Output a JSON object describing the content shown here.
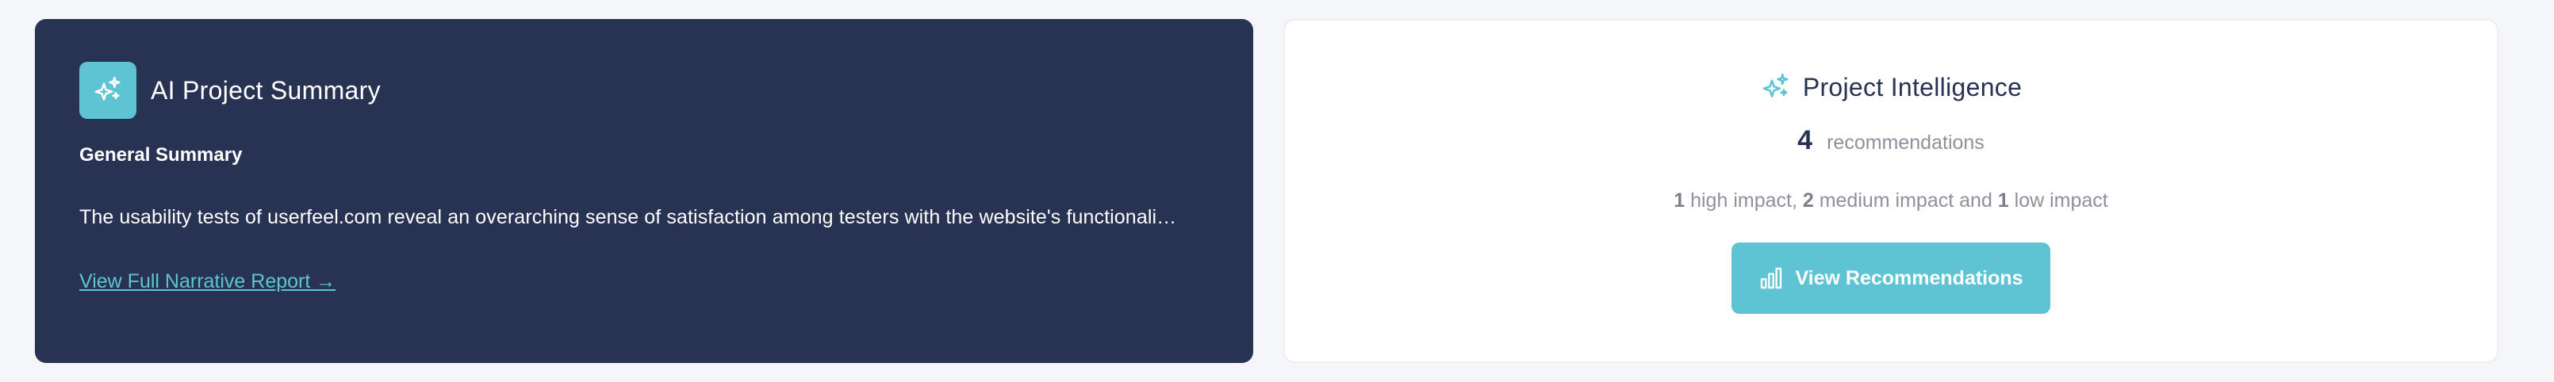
{
  "summary_card": {
    "title": "AI Project Summary",
    "subtitle": "General Summary",
    "text": "The usability tests of userfeel.com reveal an overarching sense of satisfaction among testers with the website's functionali…",
    "link_label": "View Full Narrative Report →",
    "icon": "sparkles-icon"
  },
  "intelligence_card": {
    "title": "Project Intelligence",
    "icon": "sparkles-icon",
    "count": "4",
    "count_label": "recommendations",
    "impact": {
      "high_count": "1",
      "high_label": " high impact, ",
      "medium_count": "2",
      "medium_label": " medium impact and ",
      "low_count": "1",
      "low_label": " low impact"
    },
    "button_label": "View Recommendations",
    "button_icon": "bar-chart-icon"
  },
  "colors": {
    "summary_bg": "#283252",
    "accent": "#5ec4d3",
    "page_bg": "#f5f6fa",
    "muted_text": "#8e919c"
  }
}
